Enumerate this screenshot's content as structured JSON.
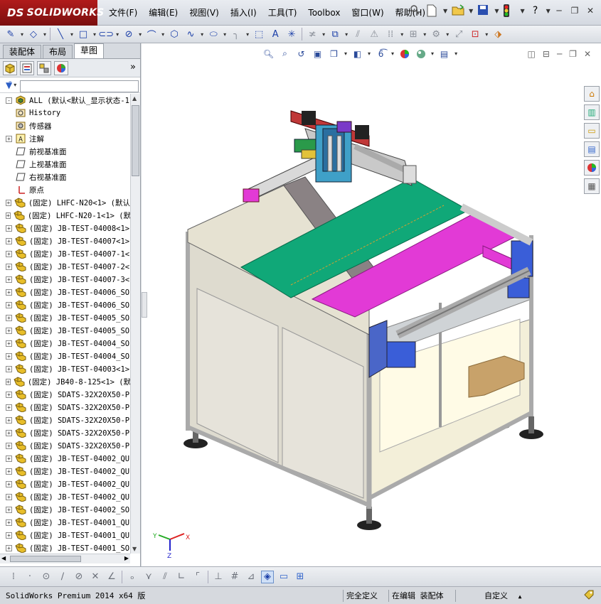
{
  "app": {
    "logo_text": "SOLIDWORKS",
    "logo_mark": "DS",
    "brand_color": "#a31515"
  },
  "menu": [
    "文件(F)",
    "编辑(E)",
    "视图(V)",
    "插入(I)",
    "工具(T)",
    "Toolbox",
    "窗口(W)",
    "帮助(H)"
  ],
  "title_icons": [
    "pin-icon",
    "new-file-icon",
    "open-file-icon",
    "save-icon",
    "rebuild-traffic-light-icon",
    "help-icon"
  ],
  "window_controls": [
    "minimize",
    "restore",
    "close"
  ],
  "sketch_toolbar": [
    "sketch-icon",
    "smart-dimension-icon",
    "line-icon",
    "rectangle-icon",
    "slot-icon",
    "circle-icon",
    "arc-icon",
    "polygon-icon",
    "spline-icon",
    "ellipse-icon",
    "fillet-icon",
    "offset-icon",
    "text-icon",
    "point-icon",
    "trim-icon",
    "convert-icon",
    "mirror-icon",
    "linear-pattern-icon",
    "move-icon",
    "display-relations-icon",
    "repair-icon",
    "quick-snaps-icon",
    "rapid-sketch-icon"
  ],
  "feature_tabs": [
    "装配体",
    "布局",
    "草图"
  ],
  "active_tab": "草图",
  "feature_manager_icons": [
    "feature-manager-icon",
    "property-manager-icon",
    "configuration-manager-icon",
    "display-manager-icon"
  ],
  "tree": [
    {
      "label": "ALL  (默认<默认_显示状态-1",
      "icon": "assembly",
      "expand": "-",
      "indent": 0
    },
    {
      "label": "History",
      "icon": "history",
      "expand": "",
      "indent": 1
    },
    {
      "label": "传感器",
      "icon": "sensor",
      "expand": "",
      "indent": 1
    },
    {
      "label": "注解",
      "icon": "annotation",
      "expand": "+",
      "indent": 1
    },
    {
      "label": "前视基准面",
      "icon": "plane",
      "expand": "",
      "indent": 1
    },
    {
      "label": "上视基准面",
      "icon": "plane",
      "expand": "",
      "indent": 1
    },
    {
      "label": "右视基准面",
      "icon": "plane",
      "expand": "",
      "indent": 1
    },
    {
      "label": "原点",
      "icon": "origin",
      "expand": "",
      "indent": 1
    },
    {
      "label": "(固定) LHFC-N20<1> (默认",
      "icon": "part",
      "expand": "+",
      "indent": 1
    },
    {
      "label": "(固定) LHFC-N20-1<1> (默",
      "icon": "part",
      "expand": "+",
      "indent": 1
    },
    {
      "label": "(固定) JB-TEST-04008<1>",
      "icon": "part",
      "expand": "+",
      "indent": 1
    },
    {
      "label": "(固定) JB-TEST-04007<1>",
      "icon": "part",
      "expand": "+",
      "indent": 1
    },
    {
      "label": "(固定) JB-TEST-04007-1<",
      "icon": "part",
      "expand": "+",
      "indent": 1
    },
    {
      "label": "(固定) JB-TEST-04007-2<",
      "icon": "part",
      "expand": "+",
      "indent": 1
    },
    {
      "label": "(固定) JB-TEST-04007-3<",
      "icon": "part",
      "expand": "+",
      "indent": 1
    },
    {
      "label": "(固定) JB-TEST-04006_SO",
      "icon": "part",
      "expand": "+",
      "indent": 1
    },
    {
      "label": "(固定) JB-TEST-04006_SO",
      "icon": "part",
      "expand": "+",
      "indent": 1
    },
    {
      "label": "(固定) JB-TEST-04005_SO",
      "icon": "part",
      "expand": "+",
      "indent": 1
    },
    {
      "label": "(固定) JB-TEST-04005_SO",
      "icon": "part",
      "expand": "+",
      "indent": 1
    },
    {
      "label": "(固定) JB-TEST-04004_SO",
      "icon": "part",
      "expand": "+",
      "indent": 1
    },
    {
      "label": "(固定) JB-TEST-04004_SO",
      "icon": "part",
      "expand": "+",
      "indent": 1
    },
    {
      "label": "(固定) JB-TEST-04003<1>",
      "icon": "part",
      "expand": "+",
      "indent": 1
    },
    {
      "label": "(固定) JB40-8-125<1> (默",
      "icon": "part",
      "expand": "+",
      "indent": 1
    },
    {
      "label": "(固定) SDATS-32X20X50-P",
      "icon": "part",
      "expand": "+",
      "indent": 1
    },
    {
      "label": "(固定) SDATS-32X20X50-P",
      "icon": "part",
      "expand": "+",
      "indent": 1
    },
    {
      "label": "(固定) SDATS-32X20X50-P",
      "icon": "part",
      "expand": "+",
      "indent": 1
    },
    {
      "label": "(固定) SDATS-32X20X50-P",
      "icon": "part",
      "expand": "+",
      "indent": 1
    },
    {
      "label": "(固定) SDATS-32X20X50-P",
      "icon": "part",
      "expand": "+",
      "indent": 1
    },
    {
      "label": "(固定) JB-TEST-04002_QU",
      "icon": "part",
      "expand": "+",
      "indent": 1
    },
    {
      "label": "(固定) JB-TEST-04002_QU",
      "icon": "part",
      "expand": "+",
      "indent": 1
    },
    {
      "label": "(固定) JB-TEST-04002_QU",
      "icon": "part",
      "expand": "+",
      "indent": 1
    },
    {
      "label": "(固定) JB-TEST-04002_QU",
      "icon": "part",
      "expand": "+",
      "indent": 1
    },
    {
      "label": "(固定) JB-TEST-04002_SO",
      "icon": "part",
      "expand": "+",
      "indent": 1
    },
    {
      "label": "(固定) JB-TEST-04001_QU",
      "icon": "part",
      "expand": "+",
      "indent": 1
    },
    {
      "label": "(固定) JB-TEST-04001_QU",
      "icon": "part",
      "expand": "+",
      "indent": 1
    },
    {
      "label": "(固定) JB-TEST-04001_SO",
      "icon": "part",
      "expand": "+",
      "indent": 1
    }
  ],
  "heads_up_toolbar": [
    "zoom-to-fit-icon",
    "zoom-to-area-icon",
    "previous-view-icon",
    "section-view-icon",
    "view-orientation-icon",
    "display-style-icon",
    "hide-show-items-icon",
    "edit-appearance-icon",
    "apply-scene-icon",
    "view-settings-icon"
  ],
  "task_pane": [
    "solidworks-resources-icon",
    "design-library-icon",
    "file-explorer-icon",
    "view-palette-icon",
    "appearances-icon",
    "custom-properties-icon"
  ],
  "triad": {
    "x": "X",
    "y": "Y",
    "z": "Z"
  },
  "bottom_toolbar": [
    "point-icon",
    "circle-icon",
    "line-icon",
    "trim-icon",
    "angle-icon",
    "tangent-icon",
    "merge-icon",
    "parallel-icon",
    "perpendicular-icon",
    "corner-icon",
    "midpoint-icon",
    "grid-icon",
    "section-icon",
    "shaded-cube-icon",
    "view-icon",
    "layout-icon"
  ],
  "status": {
    "product": "SolidWorks Premium 2014 x64 版",
    "definition": "完全定义",
    "editing": "在编辑 装配体",
    "units": "自定义",
    "units_caret": "▲"
  },
  "colors": {
    "green_plate": "#10a878",
    "magenta_plate": "#e23ad6",
    "frame_beige": "#e6e2d2",
    "blue_block": "#3a5ed8",
    "cardboard": "#c8a26a"
  }
}
